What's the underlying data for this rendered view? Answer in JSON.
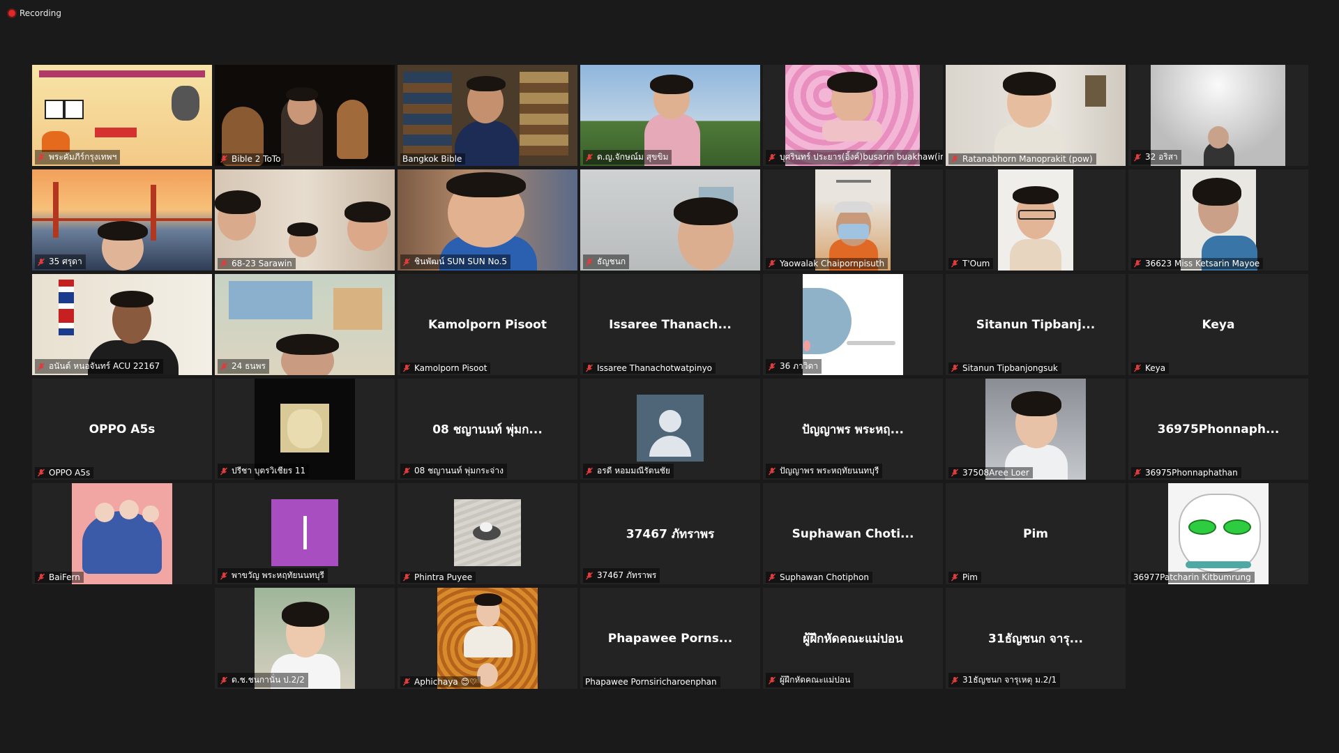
{
  "status": {
    "recording_label": "Recording"
  },
  "tiles": [
    {
      "label": "พระคัมภีร์กรุงเทพฯ",
      "muted": true
    },
    {
      "label": "Bible 2 ToTo",
      "muted": true
    },
    {
      "label": "Bangkok Bible",
      "muted": false,
      "active": true
    },
    {
      "label": "ด.ญ.จักษณ์ม สุขขิม",
      "muted": true
    },
    {
      "label": "บุศรินทร์ ประยาร(อิ้งค์)busarin buakhaw(in...",
      "muted": true
    },
    {
      "label": "Ratanabhorn Manoprakit (pow)",
      "muted": true
    },
    {
      "label": "32 อริสา",
      "muted": true
    },
    {
      "label": "35 ศรุดา",
      "muted": true
    },
    {
      "label": "68-23 Sarawin",
      "muted": true
    },
    {
      "label": "ชินพัฒน์ SUN SUN No.5",
      "muted": true
    },
    {
      "label": "ธัญชนก",
      "muted": true
    },
    {
      "label": "Yaowalak Chaipornpisuth",
      "muted": true
    },
    {
      "label": "T'Oum",
      "muted": true
    },
    {
      "label": "36623 Miss Ketsarin Mayoe",
      "muted": true
    },
    {
      "label": "อนันต์ หนอจันทร์ ACU 22167",
      "muted": true
    },
    {
      "label": "24 ธนพร",
      "muted": true
    },
    {
      "label": "Kamolporn Pisoot",
      "muted": true,
      "center": "Kamolporn Pisoot"
    },
    {
      "label": "Issaree Thanachotwatpinyo",
      "muted": true,
      "center": "Issaree Thanach..."
    },
    {
      "label": "36 ภาวิดา",
      "muted": true
    },
    {
      "label": "Sitanun Tipbanjongsuk",
      "muted": true,
      "center": "Sitanun Tipbanj..."
    },
    {
      "label": "Keya",
      "muted": true,
      "center": "Keya"
    },
    {
      "label": "OPPO A5s",
      "muted": true,
      "center": "OPPO A5s"
    },
    {
      "label": "ปรีชา บุตรวิเชียร 11",
      "muted": true
    },
    {
      "label": "08 ชญานนท์ พุ่มกระจ่าง",
      "muted": true,
      "center": "08 ชญานนท์ พุ่มก..."
    },
    {
      "label": "อรดี หอมมณีรัตนชัย",
      "muted": true
    },
    {
      "label": "ปัญญาพร พระหฤทัยนนทบุรี",
      "muted": true,
      "center": "ปัญญาพร พระหฤ..."
    },
    {
      "label": "37508Aree Loer",
      "muted": true
    },
    {
      "label": "36975Phonnaphathan",
      "muted": true,
      "center": "36975Phonnaph..."
    },
    {
      "label": "BaiFern",
      "muted": true
    },
    {
      "label": "พาขวัญ พระหฤทัยนนทบุรี",
      "muted": true
    },
    {
      "label": "Phintra Puyee",
      "muted": true
    },
    {
      "label": "37467 ภัทราพร",
      "muted": true,
      "center": "37467 ภัทราพร"
    },
    {
      "label": "Suphawan Chotiphon",
      "muted": true,
      "center": "Suphawan Choti..."
    },
    {
      "label": "Pim",
      "muted": true,
      "center": "Pim"
    },
    {
      "label": "36977Patcharin Kitbumrung",
      "muted": false
    },
    {
      "label": "",
      "muted": false,
      "empty": true
    },
    {
      "label": "ด.ช.ชนกานั่น ป.2/2",
      "muted": true
    },
    {
      "label": "Aphichaya 😊♡",
      "muted": true
    },
    {
      "label": "Phapawee Pornsiricharoenphan",
      "muted": false,
      "center": "Phapawee Porns..."
    },
    {
      "label": "ผู้ฝึกหัดคณะแม่ปอน",
      "muted": true,
      "center": "ผู้ฝึกหัดคณะแม่ปอน"
    },
    {
      "label": "31ธัญชนก จารุเหตุ ม.2/1",
      "muted": true,
      "center": "31ธัญชนก จารุ..."
    }
  ]
}
